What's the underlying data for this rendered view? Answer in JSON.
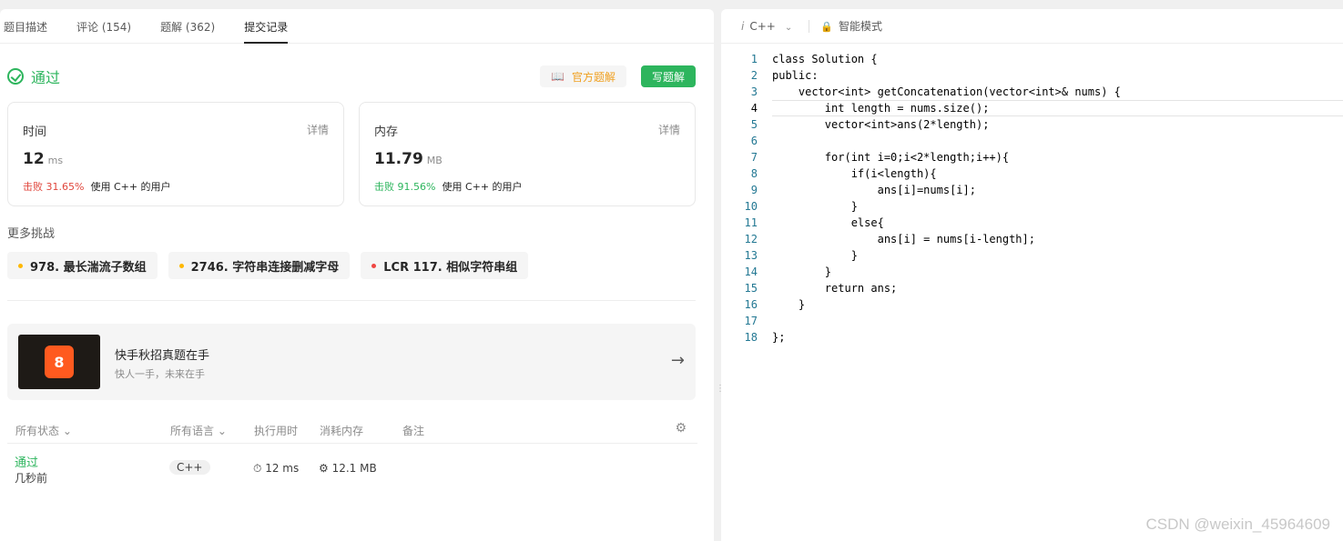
{
  "tabs": [
    "题目描述",
    "评论 (154)",
    "题解 (362)",
    "提交记录"
  ],
  "status": {
    "label": "通过",
    "official_solution": "官方题解",
    "write_solution": "写题解"
  },
  "time_card": {
    "title": "时间",
    "detail": "详情",
    "value": "12",
    "unit": "ms",
    "beat_pct": "击败 31.65%",
    "beat_text": "使用 C++ 的用户"
  },
  "memory_card": {
    "title": "内存",
    "detail": "详情",
    "value": "11.79",
    "unit": "MB",
    "beat_pct": "击败 91.56%",
    "beat_text": "使用 C++ 的用户"
  },
  "more": {
    "title": "更多挑战",
    "items": [
      {
        "label": "978. 最长湍流子数组",
        "color": "#ffb800"
      },
      {
        "label": "2746. 字符串连接删减字母",
        "color": "#ffb800"
      },
      {
        "label": "LCR 117. 相似字符串组",
        "color": "#ef4743"
      }
    ]
  },
  "banner": {
    "title": "快手秋招真题在手",
    "subtitle": "快人一手，未来在手",
    "logo_text": "8"
  },
  "table": {
    "headers": [
      "所有状态",
      "所有语言",
      "执行用时",
      "消耗内存",
      "备注"
    ],
    "row": {
      "status": "通过",
      "time_ago": "几秒前",
      "language": "C++",
      "runtime": "12 ms",
      "memory": "12.1 MB"
    }
  },
  "editor": {
    "language": "C++",
    "mode": "智能模式",
    "current_line": 4,
    "lines": [
      "class Solution {",
      "public:",
      "    vector<int> getConcatenation(vector<int>& nums) {",
      "        int length = nums.size();",
      "        vector<int>ans(2*length);",
      "",
      "        for(int i=0;i<2*length;i++){",
      "            if(i<length){",
      "                ans[i]=nums[i];",
      "            }",
      "            else{",
      "                ans[i] = nums[i-length];",
      "            }",
      "        }",
      "        return ans;",
      "    }",
      "",
      "};"
    ]
  },
  "watermark": "CSDN @weixin_45964609"
}
